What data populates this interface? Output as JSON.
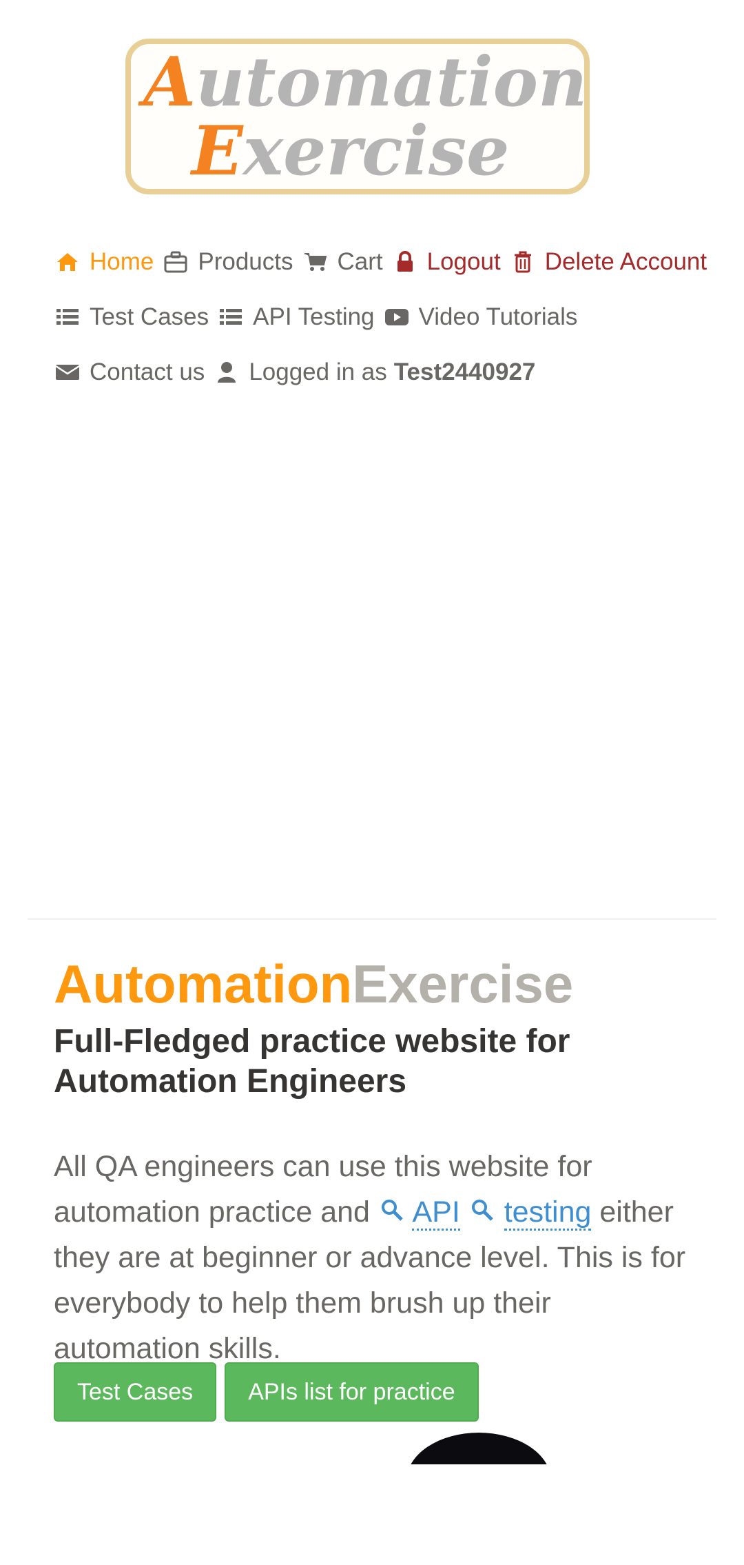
{
  "logo": {
    "line1_cap": "A",
    "line1_rest": "utomation",
    "line2_cap": "E",
    "line2_rest": "xercise"
  },
  "nav": {
    "home": "Home",
    "products": "Products",
    "cart": "Cart",
    "logout": "Logout",
    "delete_account": "Delete Account",
    "test_cases": "Test Cases",
    "api_testing": "API Testing",
    "video_tutorials": "Video Tutorials",
    "contact_us": "Contact us",
    "logged_in_prefix": "Logged in as",
    "username": "Test2440927"
  },
  "hero": {
    "title_part1": "Automation",
    "title_part2": "Exercise",
    "subtitle": "Full-Fledged practice website for Automation Engineers",
    "text_before": "All QA engineers can use this website for automation practice and ",
    "link_api": "API",
    "link_testing": "testing",
    "text_after": " either they are at beginner or advance level. This is for everybody to help them brush up their automation skills.",
    "btn_test_cases": "Test Cases",
    "btn_apis_list": "APIs list for practice"
  },
  "colors": {
    "accent": "#fe980f",
    "danger": "#a52a2a",
    "button_green": "#5cb85c",
    "link_blue": "#3e8ed0"
  }
}
